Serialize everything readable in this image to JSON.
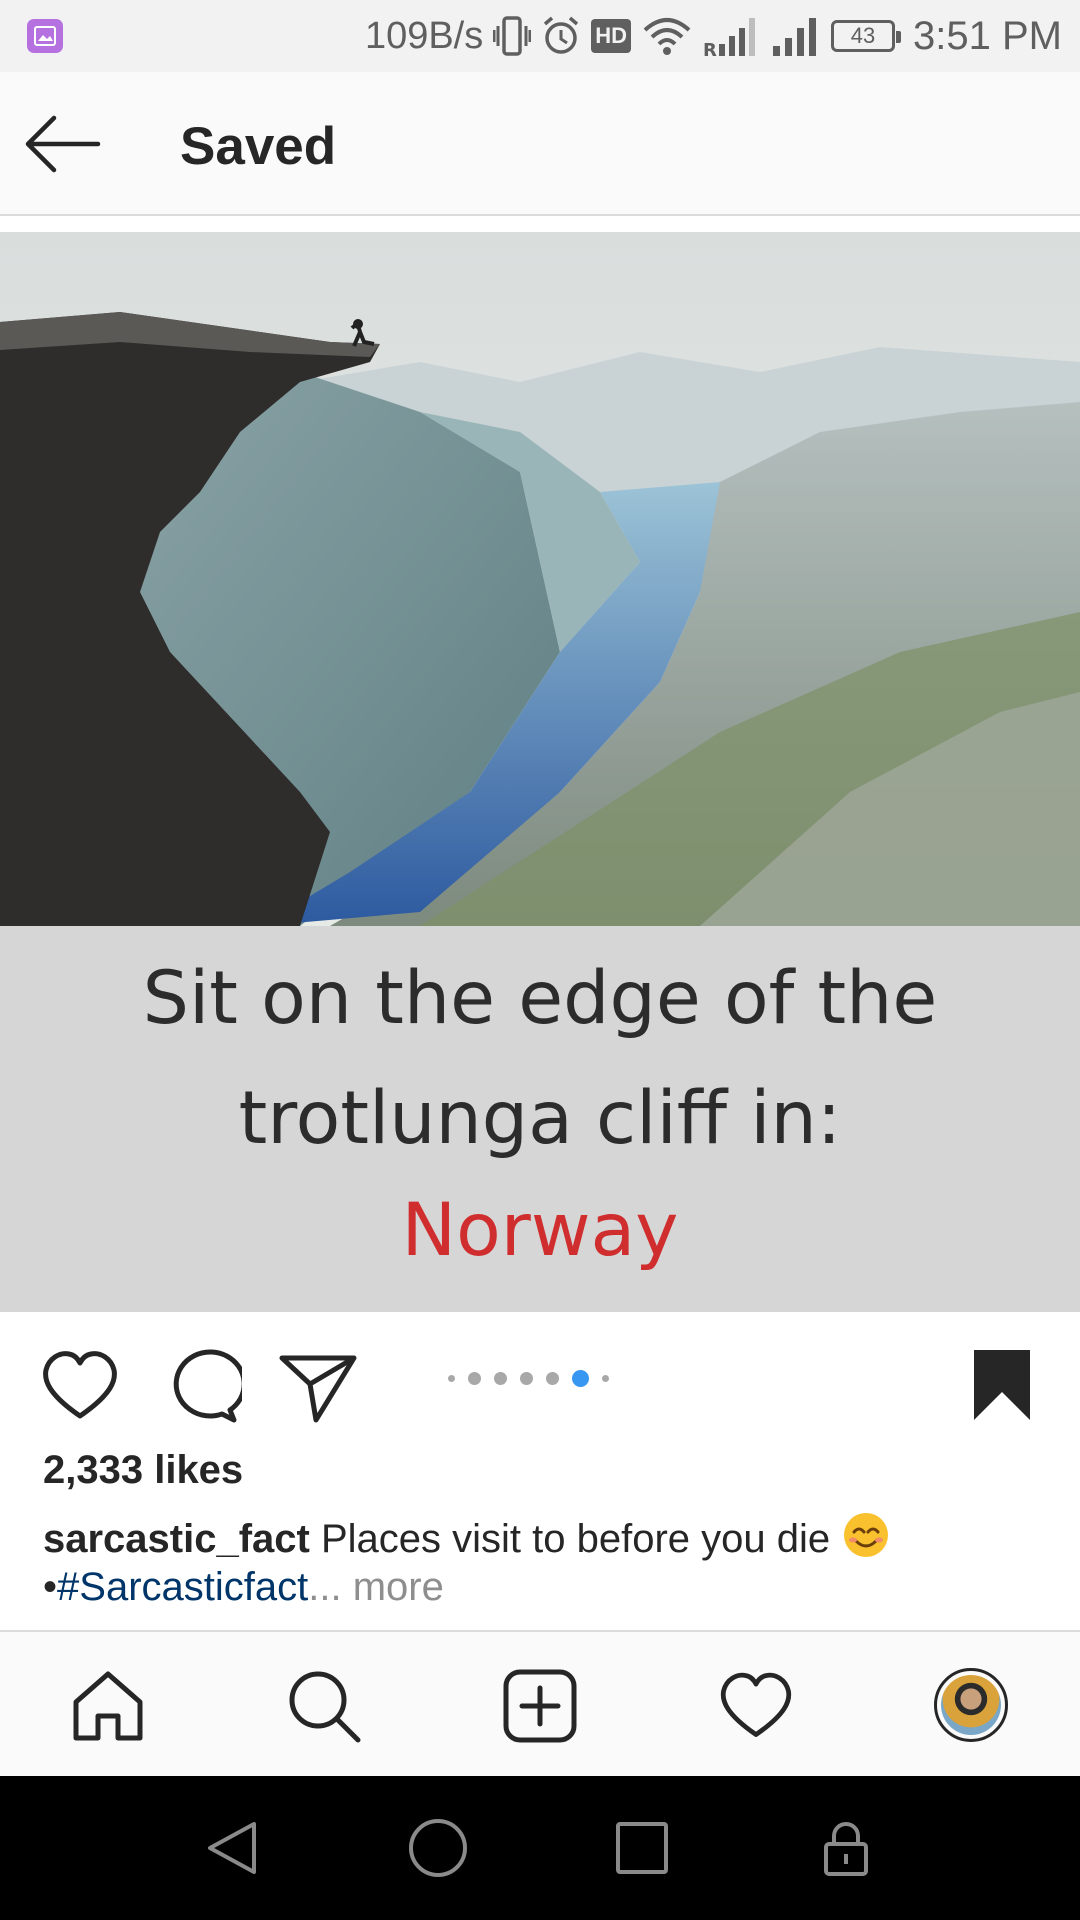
{
  "status_bar": {
    "network_speed": "109B/s",
    "hd_badge": "HD",
    "roaming_label": "R",
    "battery_level": "43",
    "time": "3:51 PM"
  },
  "app_bar": {
    "title": "Saved"
  },
  "post": {
    "image_text": {
      "line1": "Sit on the edge of the",
      "line2": "trotlunga cliff in:",
      "line3": "Norway",
      "line3_color": "#d02e2e"
    },
    "carousel": {
      "count": 7,
      "active_index": 5
    },
    "likes": "2,333 likes",
    "username": "sarcastic_fact",
    "caption_text": "Places visit to before you die",
    "caption_emoji": "smiling-face-emoji",
    "bullet": "•",
    "hashtag": "#Sarcasticfact",
    "ellipsis": "...",
    "more_label": "more",
    "saved": true
  },
  "colors": {
    "accent_blue": "#3897f0",
    "hashtag": "#003569",
    "muted": "#8e8e8e",
    "status_app_icon": "#b571e0"
  },
  "bottom_nav": {
    "items": [
      "home-icon",
      "search-icon",
      "add-post-icon",
      "activity-heart-icon",
      "profile-avatar"
    ]
  },
  "system_nav": {
    "items": [
      "back-triangle-icon",
      "home-circle-icon",
      "recents-square-icon",
      "lock-icon"
    ]
  }
}
